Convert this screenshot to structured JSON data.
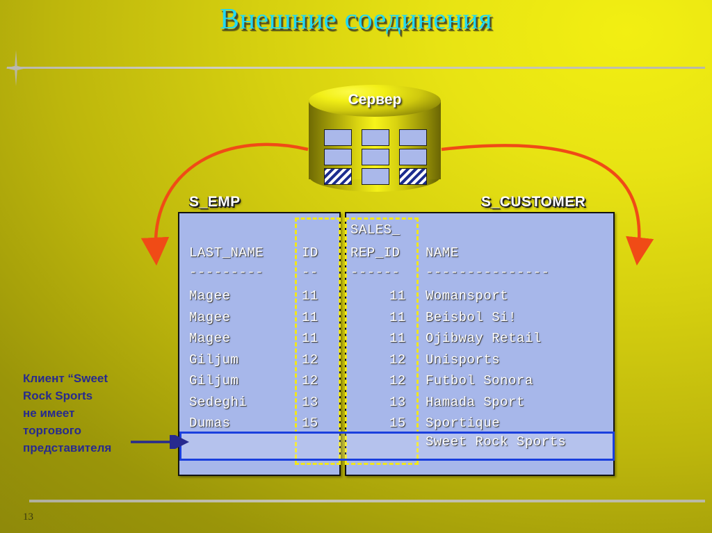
{
  "slide": {
    "title": "Внешние соединения",
    "page_number": "13",
    "accent_title_color": "#22d8f2",
    "background_color": "#cfc90e",
    "panel_color": "#a7b7ea",
    "selection_color": "#f2e71a",
    "highlight_color": "#1a3fdd",
    "arrow_color": "#f04b16"
  },
  "server": {
    "label": "Сервер",
    "cells": [
      {
        "name": "cell-1",
        "style": "plain"
      },
      {
        "name": "cell-2",
        "style": "plain"
      },
      {
        "name": "cell-3",
        "style": "plain"
      },
      {
        "name": "cell-4",
        "style": "plain"
      },
      {
        "name": "cell-5",
        "style": "plain"
      },
      {
        "name": "cell-6",
        "style": "plain"
      },
      {
        "name": "cell-7",
        "style": "hatch"
      },
      {
        "name": "cell-8",
        "style": "plain"
      },
      {
        "name": "cell-9",
        "style": "hatch"
      }
    ]
  },
  "tables": {
    "left": {
      "label": "S_EMP",
      "header_name": "LAST_NAME",
      "header_id": "ID",
      "sep_name": "---------",
      "sep_id": "--",
      "rows_name": "Magee\nMagee\nMagee\nGiljum\nGiljum\nSedeghi\nDumas",
      "rows_id": "11\n11\n11\n12\n12\n13\n15",
      "records": [
        {
          "last_name": "Magee",
          "id": "11"
        },
        {
          "last_name": "Magee",
          "id": "11"
        },
        {
          "last_name": "Magee",
          "id": "11"
        },
        {
          "last_name": "Giljum",
          "id": "12"
        },
        {
          "last_name": "Giljum",
          "id": "12"
        },
        {
          "last_name": "Sedeghi",
          "id": "13"
        },
        {
          "last_name": "Dumas",
          "id": "15"
        }
      ]
    },
    "right": {
      "label": "S_CUSTOMER",
      "header_line1": "SALES_",
      "header_line2": "REP_ID",
      "header_name": "NAME",
      "sep_repid": "------",
      "sep_name": "---------------",
      "rows_repid": "11\n11\n11\n12\n12\n13\n15",
      "rows_name": "Womansport\nBeisbol Si!\nOjibway Retail\nUnisports\nFutbol Sonora\nHamada Sport\nSportique",
      "unmatched_name": "Sweet Rock Sports",
      "records": [
        {
          "sales_rep_id": "11",
          "name": "Womansport"
        },
        {
          "sales_rep_id": "11",
          "name": "Beisbol Si!"
        },
        {
          "sales_rep_id": "11",
          "name": "Ojibway Retail"
        },
        {
          "sales_rep_id": "12",
          "name": "Unisports"
        },
        {
          "sales_rep_id": "12",
          "name": "Futbol Sonora"
        },
        {
          "sales_rep_id": "13",
          "name": "Hamada Sport"
        },
        {
          "sales_rep_id": "15",
          "name": "Sportique"
        },
        {
          "sales_rep_id": "",
          "name": "Sweet Rock Sports"
        }
      ]
    }
  },
  "caption": {
    "line1": "Клиент “Sweet",
    "line2": "Rock Sports",
    "line3": "не имеет",
    "line4": "торгового",
    "line5": "представителя"
  }
}
